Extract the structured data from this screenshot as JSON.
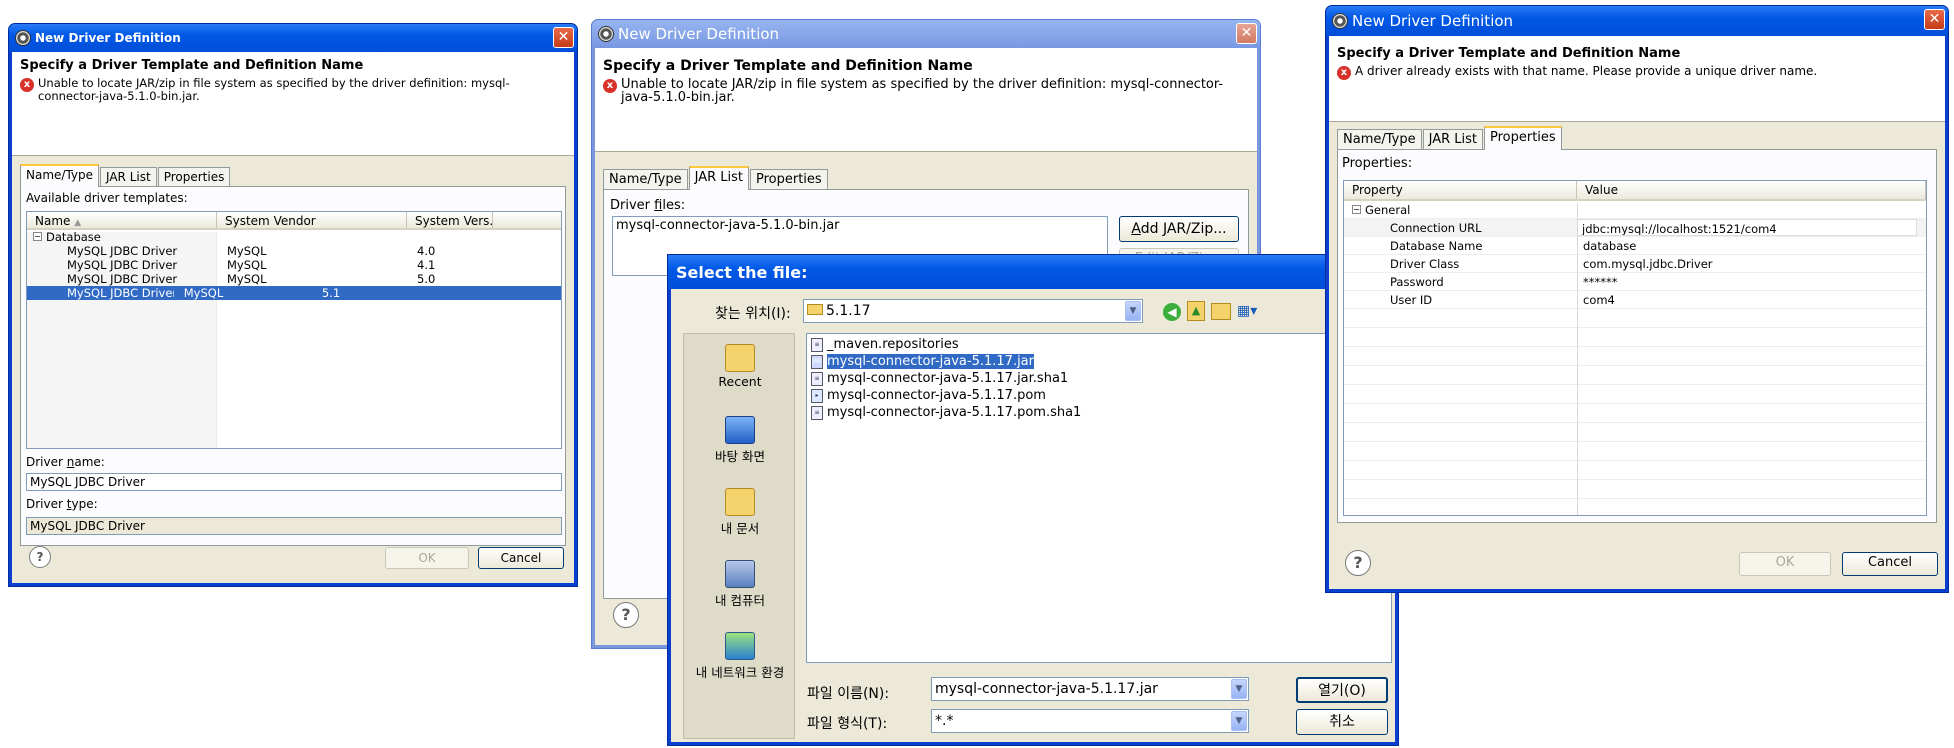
{
  "dialog1": {
    "title": "New Driver Definition",
    "heading": "Specify a Driver Template and Definition Name",
    "error_message": "Unable to locate JAR/zip in file system as specified by the driver definition: mysql-connector-java-5.1.0-bin.jar.",
    "tabs": [
      "Name/Type",
      "JAR List",
      "Properties"
    ],
    "available_label": "Available driver templates:",
    "columns": [
      "Name",
      "System Vendor",
      "System Vers..."
    ],
    "tree_root": "Database",
    "rows": [
      {
        "name": "MySQL JDBC Driver",
        "vendor": "MySQL",
        "version": "4.0"
      },
      {
        "name": "MySQL JDBC Driver",
        "vendor": "MySQL",
        "version": "4.1"
      },
      {
        "name": "MySQL JDBC Driver",
        "vendor": "MySQL",
        "version": "5.0"
      },
      {
        "name": "MySQL JDBC Driver",
        "vendor": "MySQL",
        "version": "5.1"
      }
    ],
    "driver_name_label": "Driver name:",
    "driver_name_value": "MySQL JDBC Driver",
    "driver_type_label": "Driver type:",
    "driver_type_value": "MySQL JDBC Driver",
    "ok_label": "OK",
    "cancel_label": "Cancel"
  },
  "dialog2": {
    "title": "New Driver Definition",
    "heading": "Specify a Driver Template and Definition Name",
    "error_message": "Unable to locate JAR/zip in file system as specified by the driver definition: mysql-connector-java-5.1.0-bin.jar.",
    "tabs": [
      "Name/Type",
      "JAR List",
      "Properties"
    ],
    "driver_files_label": "Driver files:",
    "driver_file": "mysql-connector-java-5.1.0-bin.jar",
    "add_jar_label": "Add JAR/Zip...",
    "edit_jar_label": "Edit JAR/Zip..."
  },
  "file_dialog": {
    "title": "Select the file:",
    "look_in_label": "찾는 위치(I):",
    "look_in_value": "5.1.17",
    "places": [
      "Recent",
      "바탕 화면",
      "내 문서",
      "내 컴퓨터",
      "내 네트워크 환경"
    ],
    "files": [
      {
        "name": "_maven.repositories",
        "icon": "text-file-icon"
      },
      {
        "name": "mysql-connector-java-5.1.17.jar",
        "icon": "jar-file-icon"
      },
      {
        "name": "mysql-connector-java-5.1.17.jar.sha1",
        "icon": "text-file-icon"
      },
      {
        "name": "mysql-connector-java-5.1.17.pom",
        "icon": "pom-file-icon"
      },
      {
        "name": "mysql-connector-java-5.1.17.pom.sha1",
        "icon": "text-file-icon"
      }
    ],
    "file_name_label": "파일 이름(N):",
    "file_name_value": "mysql-connector-java-5.1.17.jar",
    "file_type_label": "파일 형식(T):",
    "file_type_value": "*.*",
    "open_label": "열기(O)",
    "cancel_label": "취소"
  },
  "dialog3": {
    "title": "New Driver Definition",
    "heading": "Specify a Driver Template and Definition Name",
    "error_message": "A driver already exists with that name. Please provide a unique driver name.",
    "tabs": [
      "Name/Type",
      "JAR List",
      "Properties"
    ],
    "properties_label": "Properties:",
    "columns": [
      "Property",
      "Value"
    ],
    "group": "General",
    "props": [
      {
        "name": "Connection URL",
        "value": "jdbc:mysql://localhost:1521/com4"
      },
      {
        "name": "Database Name",
        "value": "database"
      },
      {
        "name": "Driver Class",
        "value": "com.mysql.jdbc.Driver"
      },
      {
        "name": "Password",
        "value": "******"
      },
      {
        "name": "User ID",
        "value": "com4"
      }
    ],
    "ok_label": "OK",
    "cancel_label": "Cancel"
  }
}
